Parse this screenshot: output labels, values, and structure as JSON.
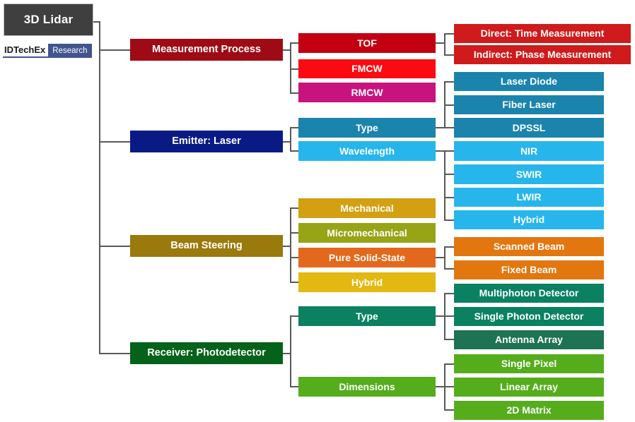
{
  "logo": {
    "root_label": "3D Lidar",
    "brand_name": "IDTechEx",
    "brand_tag": "Research",
    "root_bg": "#3f3f3f",
    "tag_bg": "#41548f"
  },
  "tree": {
    "level1": [
      {
        "label": "Measurement Process",
        "color": "#9e0b15"
      },
      {
        "label": "Emitter: Laser",
        "color": "#0a1a85"
      },
      {
        "label": "Beam Steering",
        "color": "#9a7a0d"
      },
      {
        "label": "Receiver: Photodetector",
        "color": "#05621a"
      }
    ],
    "level2": [
      {
        "label": "TOF",
        "color": "#c20012"
      },
      {
        "label": "FMCW",
        "color": "#fb0b11"
      },
      {
        "label": "RMCW",
        "color": "#c8137f"
      },
      {
        "label": "Type",
        "color": "#1b84ad"
      },
      {
        "label": "Wavelength",
        "color": "#27b6ec"
      },
      {
        "label": "Mechanical",
        "color": "#d3a012"
      },
      {
        "label": "Micromechanical",
        "color": "#97a416"
      },
      {
        "label": "Pure Solid-State",
        "color": "#e3681b"
      },
      {
        "label": "Hybrid",
        "color": "#e2b811"
      },
      {
        "label": "Type",
        "color": "#0b8162"
      },
      {
        "label": "Dimensions",
        "color": "#55ad1c"
      }
    ],
    "level3": [
      {
        "label": "Direct: Time Measurement",
        "color": "#cf1b1b"
      },
      {
        "label": "Indirect: Phase Measurement",
        "color": "#cf1b1b"
      },
      {
        "label": "Laser Diode",
        "color": "#1b84ad"
      },
      {
        "label": "Fiber Laser",
        "color": "#1b84ad"
      },
      {
        "label": "DPSSL",
        "color": "#1b84ad"
      },
      {
        "label": "NIR",
        "color": "#27b6ec"
      },
      {
        "label": "SWIR",
        "color": "#27b6ec"
      },
      {
        "label": "LWIR",
        "color": "#27b6ec"
      },
      {
        "label": "Hybrid",
        "color": "#27b6ec"
      },
      {
        "label": "Scanned Beam",
        "color": "#e2760f"
      },
      {
        "label": "Fixed Beam",
        "color": "#e2760f"
      },
      {
        "label": "Multiphoton Detector",
        "color": "#0b8162"
      },
      {
        "label": "Single Photon Detector",
        "color": "#0b8162"
      },
      {
        "label": "Antenna Array",
        "color": "#1e7354"
      },
      {
        "label": "Single Pixel",
        "color": "#55ad1c"
      },
      {
        "label": "Linear Array",
        "color": "#55ad1c"
      },
      {
        "label": "2D Matrix",
        "color": "#55ad1c"
      }
    ]
  }
}
